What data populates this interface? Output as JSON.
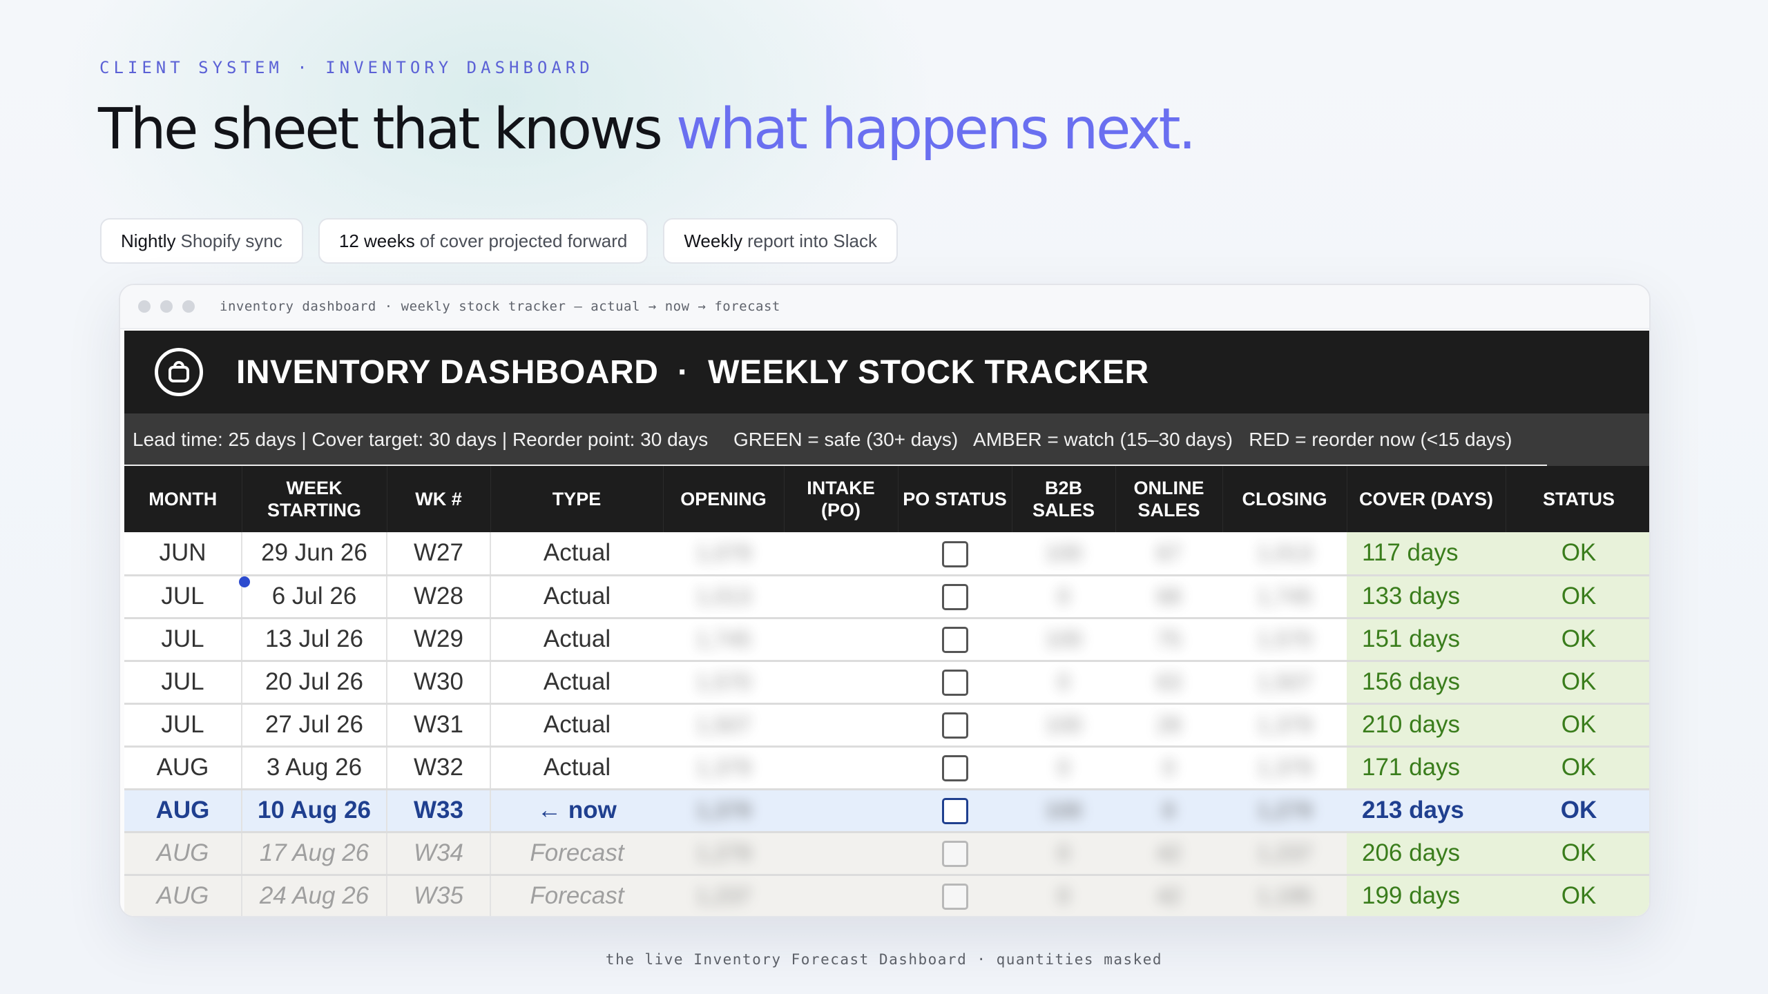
{
  "eyebrow": "CLIENT SYSTEM · INVENTORY DASHBOARD",
  "headline": {
    "main": "The sheet that knows ",
    "accent": "what happens next."
  },
  "pills": [
    {
      "strong": "Nightly",
      "rest": "Shopify sync"
    },
    {
      "strong": "12 weeks",
      "rest": "of cover projected forward"
    },
    {
      "strong": "Weekly",
      "rest": "report into Slack"
    }
  ],
  "window": {
    "title": "inventory dashboard · weekly stock tracker — actual → now → forecast"
  },
  "sheet": {
    "logo": "shopping-bag-icon",
    "title": "INVENTORY DASHBOARD  ·  WEEKLY STOCK TRACKER",
    "subinfo": "Lead time: 25 days  |  Cover target: 30 days  |  Reorder point: 30 days",
    "legend": "GREEN = safe (30+ days)   AMBER = watch (15–30 days)   RED = reorder now (<15 days)",
    "columns": [
      "MONTH",
      "WEEK STARTING",
      "WK #",
      "TYPE",
      "OPENING",
      "INTAKE (PO)",
      "PO STATUS",
      "B2B SALES",
      "ONLINE SALES",
      "CLOSING",
      "COVER (DAYS)",
      "STATUS"
    ],
    "rows": [
      {
        "month": "JUN",
        "week": "29 Jun 26",
        "wk": "W27",
        "type": "Actual",
        "opening": "1,079",
        "b2b": "100",
        "online": "67",
        "closing": "1,013",
        "cover": "117 days",
        "status": "OK",
        "kind": "actual"
      },
      {
        "month": "JUL",
        "week": "6 Jul 26",
        "wk": "W28",
        "type": "Actual",
        "opening": "1,013",
        "b2b": "0",
        "online": "68",
        "closing": "1,745",
        "cover": "133 days",
        "status": "OK",
        "kind": "actual"
      },
      {
        "month": "JUL",
        "week": "13 Jul 26",
        "wk": "W29",
        "type": "Actual",
        "opening": "1,745",
        "b2b": "100",
        "online": "75",
        "closing": "1,570",
        "cover": "151 days",
        "status": "OK",
        "kind": "actual"
      },
      {
        "month": "JUL",
        "week": "20 Jul 26",
        "wk": "W30",
        "type": "Actual",
        "opening": "1,570",
        "b2b": "0",
        "online": "63",
        "closing": "1,507",
        "cover": "156 days",
        "status": "OK",
        "kind": "actual"
      },
      {
        "month": "JUL",
        "week": "27 Jul 26",
        "wk": "W31",
        "type": "Actual",
        "opening": "1,507",
        "b2b": "100",
        "online": "28",
        "closing": "1,379",
        "cover": "210 days",
        "status": "OK",
        "kind": "actual"
      },
      {
        "month": "AUG",
        "week": "3 Aug 26",
        "wk": "W32",
        "type": "Actual",
        "opening": "1,379",
        "b2b": "0",
        "online": "0",
        "closing": "1,379",
        "cover": "171 days",
        "status": "OK",
        "kind": "actual"
      },
      {
        "month": "AUG",
        "week": "10 Aug 26",
        "wk": "W33",
        "type": "← now",
        "opening": "1,379",
        "b2b": "100",
        "online": "0",
        "closing": "1,279",
        "cover": "213 days",
        "status": "OK",
        "kind": "now"
      },
      {
        "month": "AUG",
        "week": "17 Aug 26",
        "wk": "W34",
        "type": "Forecast",
        "opening": "1,279",
        "b2b": "0",
        "online": "42",
        "closing": "1,237",
        "cover": "206 days",
        "status": "OK",
        "kind": "forecast"
      },
      {
        "month": "AUG",
        "week": "24 Aug 26",
        "wk": "W35",
        "type": "Forecast",
        "opening": "1,237",
        "b2b": "0",
        "online": "42",
        "closing": "1,195",
        "cover": "199 days",
        "status": "OK",
        "kind": "forecast"
      }
    ]
  },
  "caption": "the live Inventory Forecast Dashboard · quantities masked"
}
